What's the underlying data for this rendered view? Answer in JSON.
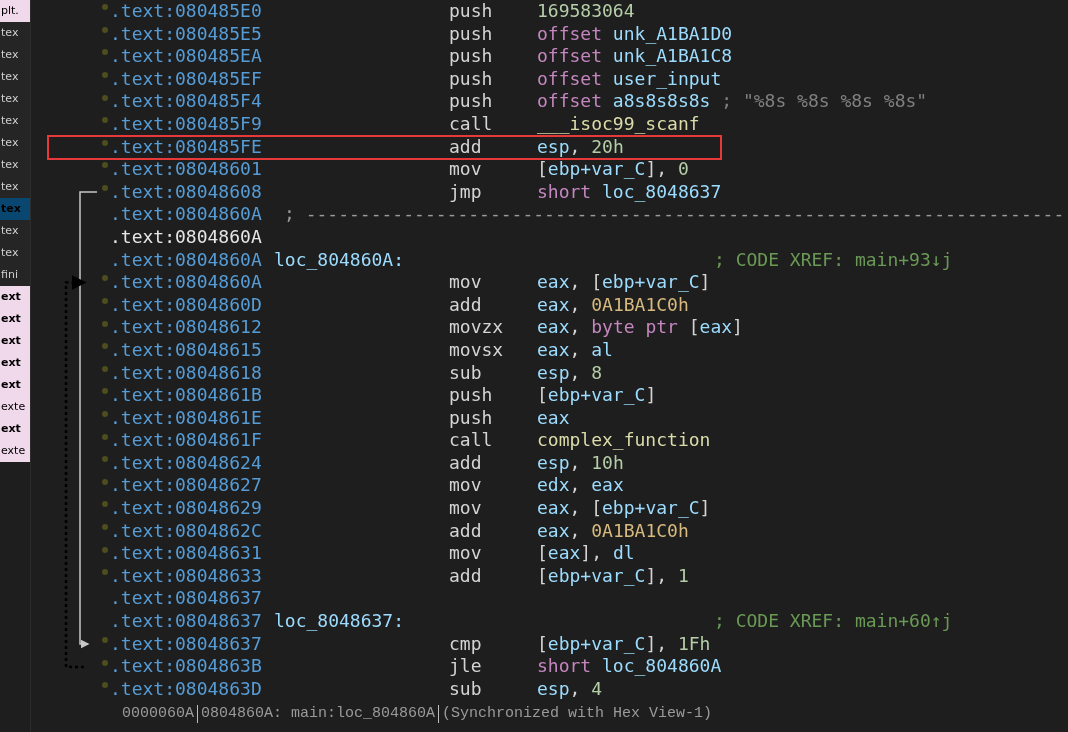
{
  "sidebar": {
    "items": [
      {
        "label": "plt.",
        "bold": false,
        "selected": false,
        "highlight": true
      },
      {
        "label": "tex",
        "bold": false,
        "selected": false,
        "highlight": false
      },
      {
        "label": "tex",
        "bold": false,
        "selected": false,
        "highlight": false
      },
      {
        "label": "tex",
        "bold": false,
        "selected": false,
        "highlight": false
      },
      {
        "label": "tex",
        "bold": false,
        "selected": false,
        "highlight": false
      },
      {
        "label": "tex",
        "bold": false,
        "selected": false,
        "highlight": false
      },
      {
        "label": "tex",
        "bold": false,
        "selected": false,
        "highlight": false
      },
      {
        "label": "tex",
        "bold": false,
        "selected": false,
        "highlight": false
      },
      {
        "label": "tex",
        "bold": false,
        "selected": false,
        "highlight": false
      },
      {
        "label": "tex",
        "bold": true,
        "selected": true,
        "highlight": false
      },
      {
        "label": "tex",
        "bold": false,
        "selected": false,
        "highlight": false
      },
      {
        "label": "tex",
        "bold": false,
        "selected": false,
        "highlight": false
      },
      {
        "label": "fini",
        "bold": false,
        "selected": false,
        "highlight": false
      },
      {
        "label": "ext",
        "bold": true,
        "selected": false,
        "highlight": true
      },
      {
        "label": "ext",
        "bold": true,
        "selected": false,
        "highlight": true
      },
      {
        "label": "ext",
        "bold": true,
        "selected": false,
        "highlight": true
      },
      {
        "label": "ext",
        "bold": true,
        "selected": false,
        "highlight": true
      },
      {
        "label": "ext",
        "bold": true,
        "selected": false,
        "highlight": true
      },
      {
        "label": "exte",
        "bold": false,
        "selected": false,
        "highlight": true
      },
      {
        "label": "ext",
        "bold": true,
        "selected": false,
        "highlight": true
      },
      {
        "label": "exte",
        "bold": false,
        "selected": false,
        "highlight": true
      }
    ]
  },
  "listing": {
    "rows": [
      {
        "kind": "ins",
        "address": ".text:080485E0",
        "mnemonic": "push",
        "operands": [
          {
            "text": "169583064",
            "kind": "num"
          }
        ]
      },
      {
        "kind": "ins",
        "address": ".text:080485E5",
        "mnemonic": "push",
        "operands": [
          {
            "text": "offset",
            "kind": "kw"
          },
          {
            "text": " unk_A1BA1D0",
            "kind": "sym"
          }
        ]
      },
      {
        "kind": "ins",
        "address": ".text:080485EA",
        "mnemonic": "push",
        "operands": [
          {
            "text": "offset",
            "kind": "kw"
          },
          {
            "text": " unk_A1BA1C8",
            "kind": "sym"
          }
        ]
      },
      {
        "kind": "ins",
        "address": ".text:080485EF",
        "mnemonic": "push",
        "operands": [
          {
            "text": "offset",
            "kind": "kw"
          },
          {
            "text": " user_input",
            "kind": "sym"
          }
        ]
      },
      {
        "kind": "ins",
        "address": ".text:080485F4",
        "mnemonic": "push",
        "operands": [
          {
            "text": "offset",
            "kind": "kw"
          },
          {
            "text": " a8s8s8s8s",
            "kind": "sym"
          },
          {
            "text": " ; \"%8s %8s %8s %8s\"",
            "kind": "comment"
          }
        ]
      },
      {
        "kind": "ins",
        "address": ".text:080485F9",
        "mnemonic": "call",
        "operands": [
          {
            "text": "___isoc99_scanf",
            "kind": "func"
          }
        ]
      },
      {
        "kind": "ins",
        "address": ".text:080485FE",
        "mnemonic": "add",
        "operands": [
          {
            "text": "esp",
            "kind": "reg"
          },
          {
            "text": ", ",
            "kind": "punct"
          },
          {
            "text": "20h",
            "kind": "num"
          }
        ]
      },
      {
        "kind": "ins",
        "address": ".text:08048601",
        "mnemonic": "mov",
        "operands": [
          {
            "text": "[",
            "kind": "punct"
          },
          {
            "text": "ebp+var_C",
            "kind": "reg"
          },
          {
            "text": "], ",
            "kind": "punct"
          },
          {
            "text": "0",
            "kind": "num"
          }
        ]
      },
      {
        "kind": "ins",
        "address": ".text:08048608",
        "mnemonic": "jmp",
        "operands": [
          {
            "text": "short",
            "kind": "kw"
          },
          {
            "text": " loc_8048637",
            "kind": "sym"
          }
        ]
      },
      {
        "kind": "sep",
        "address": ".text:0804860A",
        "comment": "; ----------------------------------------------------------------------"
      },
      {
        "kind": "blank",
        "address": ".text:0804860A",
        "current": true
      },
      {
        "kind": "label",
        "address": ".text:0804860A",
        "label": "loc_804860A:",
        "comment": "; CODE XREF: main+93↓j"
      },
      {
        "kind": "ins",
        "address": ".text:0804860A",
        "mnemonic": "mov",
        "operands": [
          {
            "text": "eax",
            "kind": "reg"
          },
          {
            "text": ", [",
            "kind": "punct"
          },
          {
            "text": "ebp+var_C",
            "kind": "reg"
          },
          {
            "text": "]",
            "kind": "punct"
          }
        ]
      },
      {
        "kind": "ins",
        "address": ".text:0804860D",
        "mnemonic": "add",
        "operands": [
          {
            "text": "eax",
            "kind": "reg"
          },
          {
            "text": ", ",
            "kind": "punct"
          },
          {
            "text": "0A1BA1C0h",
            "kind": "hex"
          }
        ]
      },
      {
        "kind": "ins",
        "address": ".text:08048612",
        "mnemonic": "movzx",
        "operands": [
          {
            "text": "eax",
            "kind": "reg"
          },
          {
            "text": ", ",
            "kind": "punct"
          },
          {
            "text": "byte ptr",
            "kind": "kw"
          },
          {
            "text": " [",
            "kind": "punct"
          },
          {
            "text": "eax",
            "kind": "reg"
          },
          {
            "text": "]",
            "kind": "punct"
          }
        ]
      },
      {
        "kind": "ins",
        "address": ".text:08048615",
        "mnemonic": "movsx",
        "operands": [
          {
            "text": "eax",
            "kind": "reg"
          },
          {
            "text": ", ",
            "kind": "punct"
          },
          {
            "text": "al",
            "kind": "reg"
          }
        ]
      },
      {
        "kind": "ins",
        "address": ".text:08048618",
        "mnemonic": "sub",
        "operands": [
          {
            "text": "esp",
            "kind": "reg"
          },
          {
            "text": ", ",
            "kind": "punct"
          },
          {
            "text": "8",
            "kind": "num"
          }
        ]
      },
      {
        "kind": "ins",
        "address": ".text:0804861B",
        "mnemonic": "push",
        "operands": [
          {
            "text": "[",
            "kind": "punct"
          },
          {
            "text": "ebp+var_C",
            "kind": "reg"
          },
          {
            "text": "]",
            "kind": "punct"
          }
        ]
      },
      {
        "kind": "ins",
        "address": ".text:0804861E",
        "mnemonic": "push",
        "operands": [
          {
            "text": "eax",
            "kind": "reg"
          }
        ]
      },
      {
        "kind": "ins",
        "address": ".text:0804861F",
        "mnemonic": "call",
        "operands": [
          {
            "text": "complex_function",
            "kind": "func"
          }
        ]
      },
      {
        "kind": "ins",
        "address": ".text:08048624",
        "mnemonic": "add",
        "operands": [
          {
            "text": "esp",
            "kind": "reg"
          },
          {
            "text": ", ",
            "kind": "punct"
          },
          {
            "text": "10h",
            "kind": "num"
          }
        ]
      },
      {
        "kind": "ins",
        "address": ".text:08048627",
        "mnemonic": "mov",
        "operands": [
          {
            "text": "edx",
            "kind": "reg"
          },
          {
            "text": ", ",
            "kind": "punct"
          },
          {
            "text": "eax",
            "kind": "reg"
          }
        ]
      },
      {
        "kind": "ins",
        "address": ".text:08048629",
        "mnemonic": "mov",
        "operands": [
          {
            "text": "eax",
            "kind": "reg"
          },
          {
            "text": ", [",
            "kind": "punct"
          },
          {
            "text": "ebp+var_C",
            "kind": "reg"
          },
          {
            "text": "]",
            "kind": "punct"
          }
        ]
      },
      {
        "kind": "ins",
        "address": ".text:0804862C",
        "mnemonic": "add",
        "operands": [
          {
            "text": "eax",
            "kind": "reg"
          },
          {
            "text": ", ",
            "kind": "punct"
          },
          {
            "text": "0A1BA1C0h",
            "kind": "hex"
          }
        ]
      },
      {
        "kind": "ins",
        "address": ".text:08048631",
        "mnemonic": "mov",
        "operands": [
          {
            "text": "[",
            "kind": "punct"
          },
          {
            "text": "eax",
            "kind": "reg"
          },
          {
            "text": "], ",
            "kind": "punct"
          },
          {
            "text": "dl",
            "kind": "reg"
          }
        ]
      },
      {
        "kind": "ins",
        "address": ".text:08048633",
        "mnemonic": "add",
        "operands": [
          {
            "text": "[",
            "kind": "punct"
          },
          {
            "text": "ebp+var_C",
            "kind": "reg"
          },
          {
            "text": "], ",
            "kind": "punct"
          },
          {
            "text": "1",
            "kind": "num"
          }
        ]
      },
      {
        "kind": "blank",
        "address": ".text:08048637",
        "current": false
      },
      {
        "kind": "label",
        "address": ".text:08048637",
        "label": "loc_8048637:",
        "comment": "; CODE XREF: main+60↑j"
      },
      {
        "kind": "ins",
        "address": ".text:08048637",
        "mnemonic": "cmp",
        "operands": [
          {
            "text": "[",
            "kind": "punct"
          },
          {
            "text": "ebp+var_C",
            "kind": "reg"
          },
          {
            "text": "], ",
            "kind": "punct"
          },
          {
            "text": "1Fh",
            "kind": "num"
          }
        ]
      },
      {
        "kind": "ins",
        "address": ".text:0804863B",
        "mnemonic": "jle",
        "operands": [
          {
            "text": "short",
            "kind": "kw"
          },
          {
            "text": " loc_804860A",
            "kind": "sym"
          }
        ]
      },
      {
        "kind": "ins",
        "address": ".text:0804863D",
        "mnemonic": "sub",
        "operands": [
          {
            "text": "esp",
            "kind": "reg"
          },
          {
            "text": ", ",
            "kind": "punct"
          },
          {
            "text": "4",
            "kind": "num"
          }
        ]
      }
    ]
  },
  "status_bar": {
    "offset": "0000060A",
    "location": "0804860A: main:loc_804860A",
    "sync": "(Synchronized with Hex View-1)"
  }
}
